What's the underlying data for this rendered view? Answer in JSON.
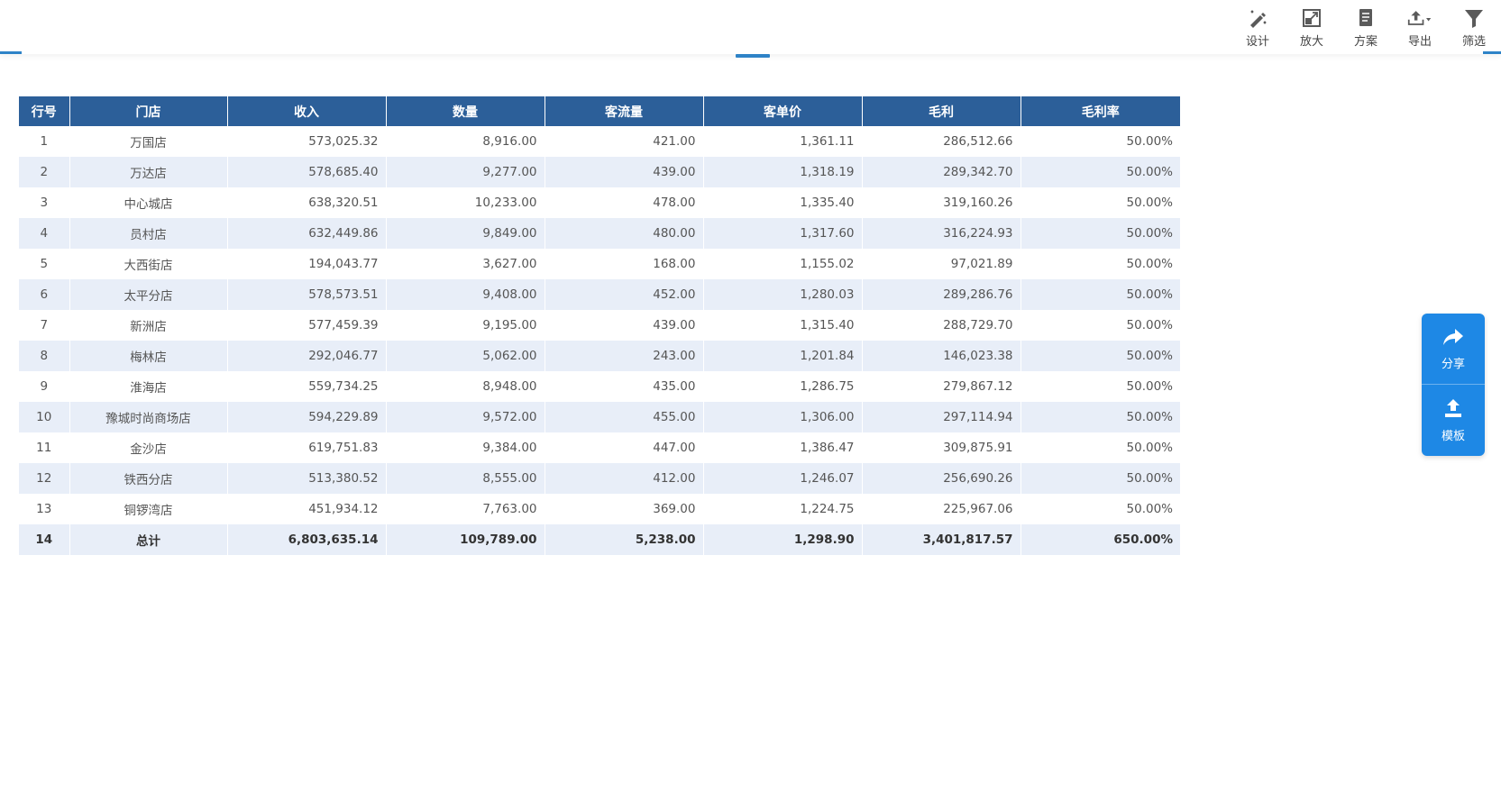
{
  "toolbar": {
    "design_label": "设计",
    "zoom_label": "放大",
    "scheme_label": "方案",
    "export_label": "导出",
    "filter_label": "筛选",
    "icons": [
      "design-icon",
      "zoom-icon",
      "scheme-icon",
      "export-icon",
      "filter-icon"
    ],
    "icon_color": "#555555"
  },
  "table": {
    "header_color": "#2c5f99",
    "stripe_color": "#e8eef8",
    "columns": [
      "行号",
      "门店",
      "收入",
      "数量",
      "客流量",
      "客单价",
      "毛利",
      "毛利率"
    ],
    "rows": [
      [
        "1",
        "万国店",
        "573,025.32",
        "8,916.00",
        "421.00",
        "1,361.11",
        "286,512.66",
        "50.00%"
      ],
      [
        "2",
        "万达店",
        "578,685.40",
        "9,277.00",
        "439.00",
        "1,318.19",
        "289,342.70",
        "50.00%"
      ],
      [
        "3",
        "中心城店",
        "638,320.51",
        "10,233.00",
        "478.00",
        "1,335.40",
        "319,160.26",
        "50.00%"
      ],
      [
        "4",
        "员村店",
        "632,449.86",
        "9,849.00",
        "480.00",
        "1,317.60",
        "316,224.93",
        "50.00%"
      ],
      [
        "5",
        "大西街店",
        "194,043.77",
        "3,627.00",
        "168.00",
        "1,155.02",
        "97,021.89",
        "50.00%"
      ],
      [
        "6",
        "太平分店",
        "578,573.51",
        "9,408.00",
        "452.00",
        "1,280.03",
        "289,286.76",
        "50.00%"
      ],
      [
        "7",
        "新洲店",
        "577,459.39",
        "9,195.00",
        "439.00",
        "1,315.40",
        "288,729.70",
        "50.00%"
      ],
      [
        "8",
        "梅林店",
        "292,046.77",
        "5,062.00",
        "243.00",
        "1,201.84",
        "146,023.38",
        "50.00%"
      ],
      [
        "9",
        "淮海店",
        "559,734.25",
        "8,948.00",
        "435.00",
        "1,286.75",
        "279,867.12",
        "50.00%"
      ],
      [
        "10",
        "豫城时尚商场店",
        "594,229.89",
        "9,572.00",
        "455.00",
        "1,306.00",
        "297,114.94",
        "50.00%"
      ],
      [
        "11",
        "金沙店",
        "619,751.83",
        "9,384.00",
        "447.00",
        "1,386.47",
        "309,875.91",
        "50.00%"
      ],
      [
        "12",
        "铁西分店",
        "513,380.52",
        "8,555.00",
        "412.00",
        "1,246.07",
        "256,690.26",
        "50.00%"
      ],
      [
        "13",
        "铜锣湾店",
        "451,934.12",
        "7,763.00",
        "369.00",
        "1,224.75",
        "225,967.06",
        "50.00%"
      ]
    ],
    "total": [
      "14",
      "总计",
      "6,803,635.14",
      "109,789.00",
      "5,238.00",
      "1,298.90",
      "3,401,817.57",
      "650.00%"
    ]
  },
  "side_panel": {
    "share_label": "分享",
    "template_label": "模板",
    "color": "#1e88e5",
    "icons": [
      "share-icon",
      "upload-icon"
    ]
  }
}
